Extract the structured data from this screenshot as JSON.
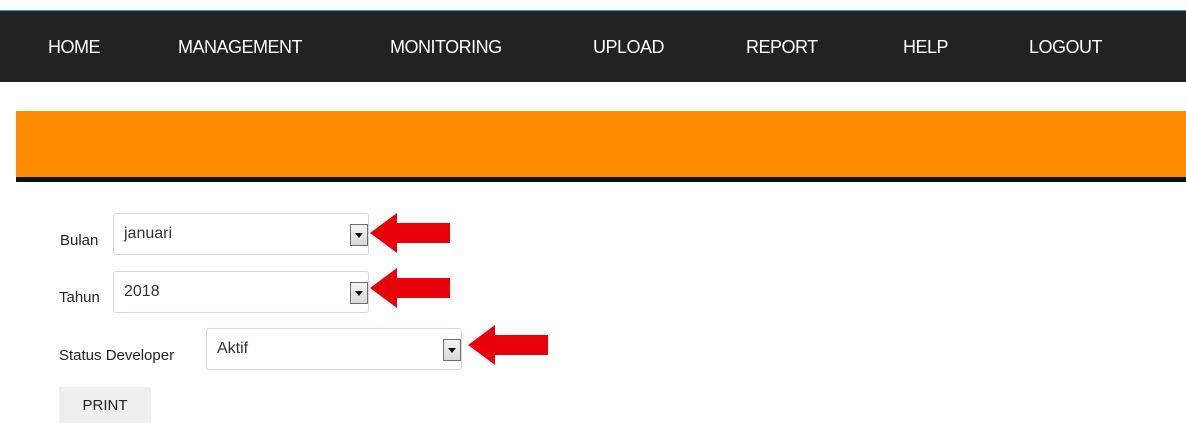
{
  "nav": {
    "items": [
      {
        "label": "HOME"
      },
      {
        "label": "MANAGEMENT"
      },
      {
        "label": "MONITORING"
      },
      {
        "label": "UPLOAD"
      },
      {
        "label": "REPORT"
      },
      {
        "label": "HELP"
      },
      {
        "label": "LOGOUT"
      }
    ]
  },
  "form": {
    "bulan": {
      "label": "Bulan",
      "value": "januari"
    },
    "tahun": {
      "label": "Tahun",
      "value": "2018"
    },
    "status": {
      "label": "Status Developer",
      "value": "Aktif"
    },
    "print_label": "PRINT"
  },
  "colors": {
    "nav_bg": "#222222",
    "nav_top_border": "#2aa3c9",
    "banner": "#ff8c00",
    "rule": "#111111",
    "annotation_arrow": "#e8000b"
  },
  "icons": {
    "dropdown": "dropdown-arrow-icon",
    "annotation": "red-arrow-icon"
  }
}
